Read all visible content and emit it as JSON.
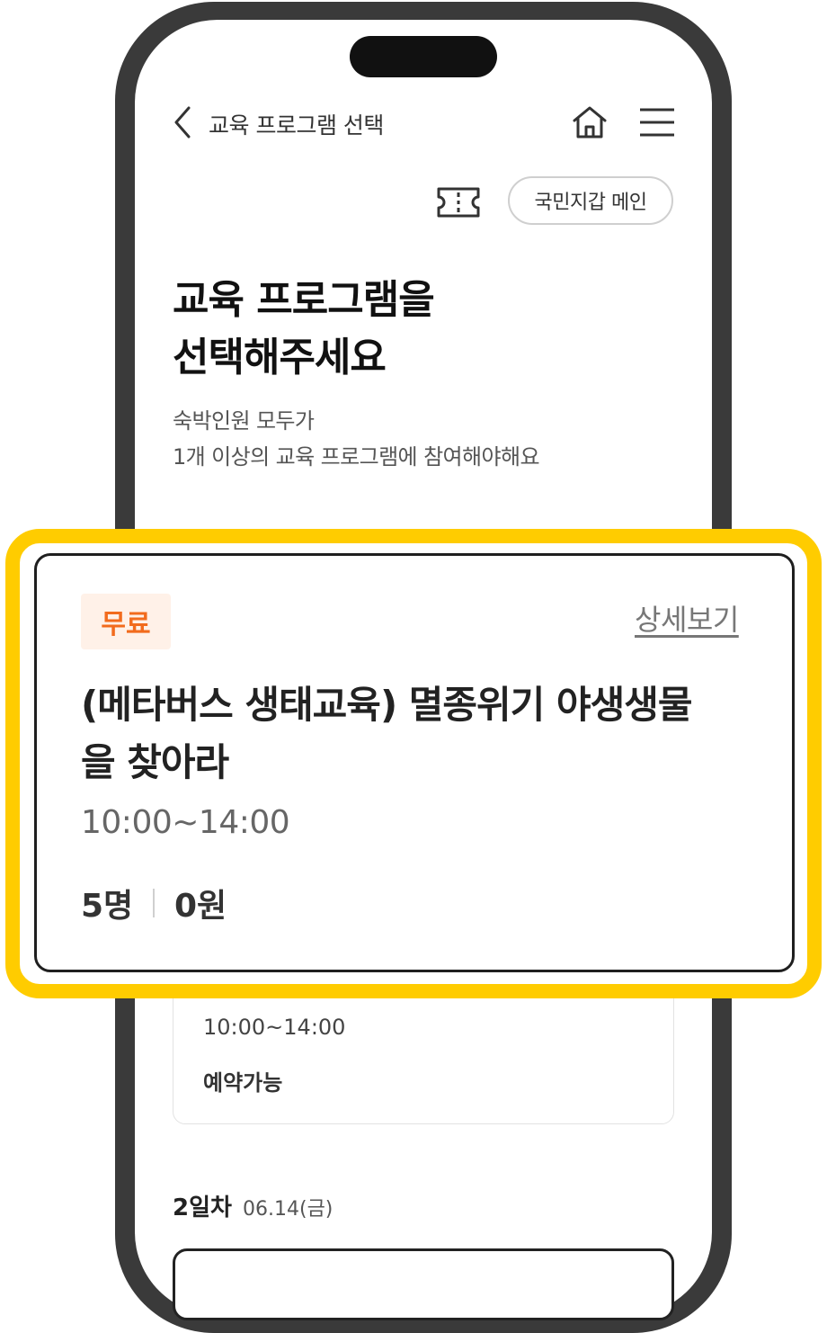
{
  "header": {
    "title": "교육 프로그램 선택"
  },
  "toolbar": {
    "wallet_button": "국민지갑 메인"
  },
  "intro": {
    "heading_line1": "교육 프로그램을",
    "heading_line2": "선택해주세요",
    "sub_line1": "숙박인원 모두가",
    "sub_line2": "1개 이상의 교육 프로그램에 참여해야해요"
  },
  "featured_program": {
    "badge": "무료",
    "detail_link": "상세보기",
    "title_line1": "(메타버스 생태교육) 멸종위기 야생생물",
    "title_line2": "을 찾아라",
    "time": "10:00~14:00",
    "capacity": "5명",
    "price": "0원"
  },
  "background_card": {
    "time": "10:00~14:00",
    "status": "예약가능"
  },
  "day2": {
    "label": "2일차",
    "date": "06.14(금)"
  },
  "colors": {
    "highlight": "#ffcc00",
    "badge_text": "#f26b1d",
    "badge_bg": "#fff1e8"
  }
}
